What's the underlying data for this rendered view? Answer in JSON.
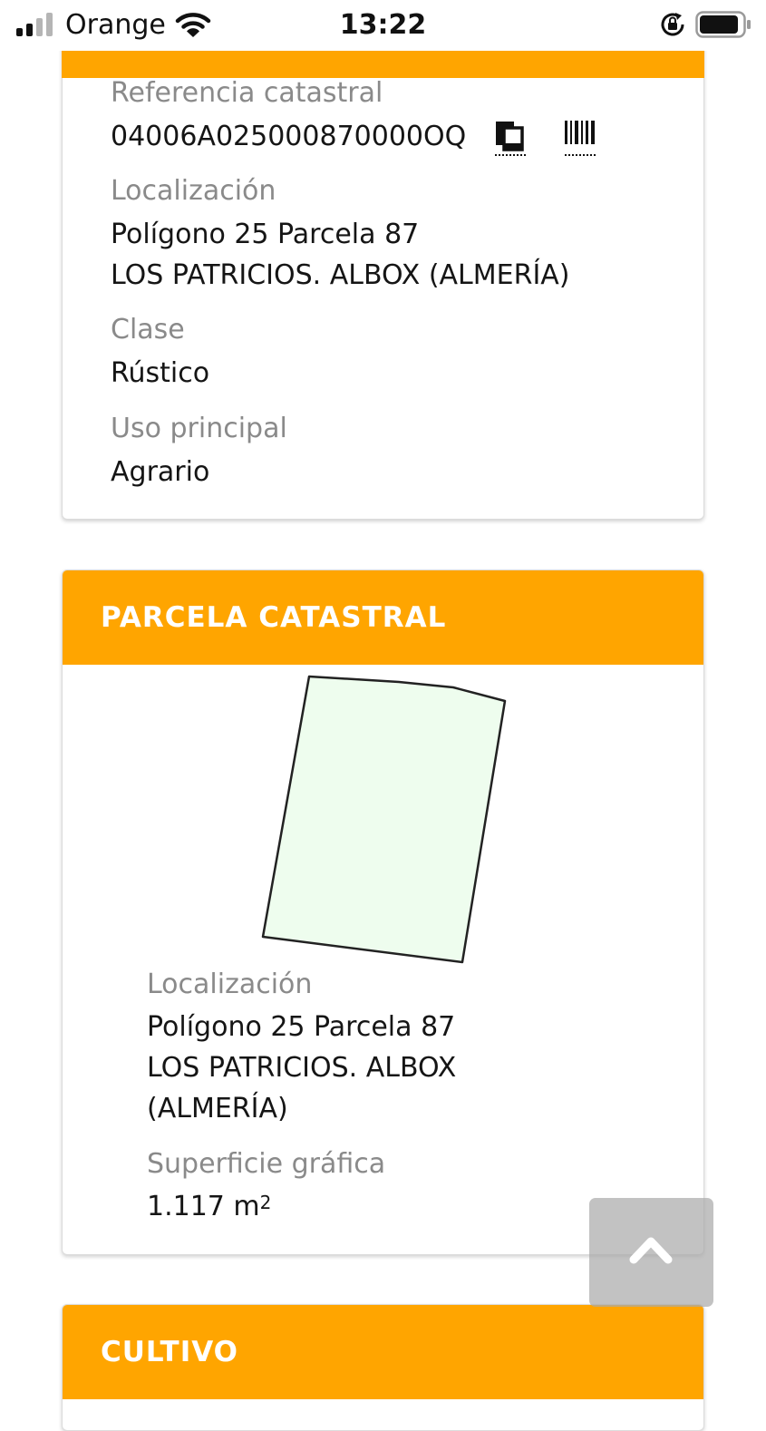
{
  "status_bar": {
    "carrier": "Orange",
    "time": "13:22"
  },
  "summary": {
    "referencia_label": "Referencia catastral",
    "referencia_value": "04006A025000870000OQ",
    "localizacion_label": "Localización",
    "localizacion_line1": "Polígono 25 Parcela 87",
    "localizacion_line2": "LOS PATRICIOS. ALBOX (ALMERÍA)",
    "clase_label": "Clase",
    "clase_value": "Rústico",
    "uso_label": "Uso principal",
    "uso_value": "Agrario"
  },
  "parcela": {
    "title": "PARCELA CATASTRAL",
    "localizacion_label": "Localización",
    "localizacion_line1": "Polígono 25 Parcela 87",
    "localizacion_line2": "LOS PATRICIOS. ALBOX",
    "localizacion_line3": "(ALMERÍA)",
    "superficie_label": "Superficie gráfica",
    "superficie_value": "1.117 m",
    "superficie_unit_exp": "2"
  },
  "cultivo": {
    "title": "CULTIVO"
  },
  "icons": {
    "copy": "copy-icon",
    "barcode": "barcode-icon",
    "scroll_top": "chevron-up-icon"
  },
  "colors": {
    "accent": "#ffa500",
    "parcel_fill": "#eefdee",
    "label": "#8a8a8a"
  }
}
